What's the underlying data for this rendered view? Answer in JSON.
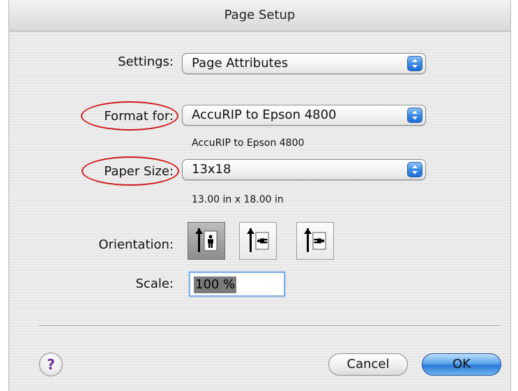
{
  "window": {
    "title": "Page Setup"
  },
  "settings": {
    "label": "Settings:",
    "value": "Page Attributes"
  },
  "format_for": {
    "label": "Format for:",
    "value": "AccuRIP to Epson 4800",
    "description": "AccuRIP to Epson 4800"
  },
  "paper_size": {
    "label": "Paper Size:",
    "value": "13x18",
    "description": "13.00 in x 18.00 in"
  },
  "orientation": {
    "label": "Orientation:",
    "options": [
      {
        "name": "portrait",
        "selected": true
      },
      {
        "name": "landscape-left",
        "selected": false
      },
      {
        "name": "landscape-right",
        "selected": false
      }
    ]
  },
  "scale": {
    "label": "Scale:",
    "value": "100 %"
  },
  "buttons": {
    "help": "?",
    "cancel": "Cancel",
    "ok": "OK"
  },
  "colors": {
    "annotation": "#d01a1a",
    "accent": "#3b8be6"
  }
}
